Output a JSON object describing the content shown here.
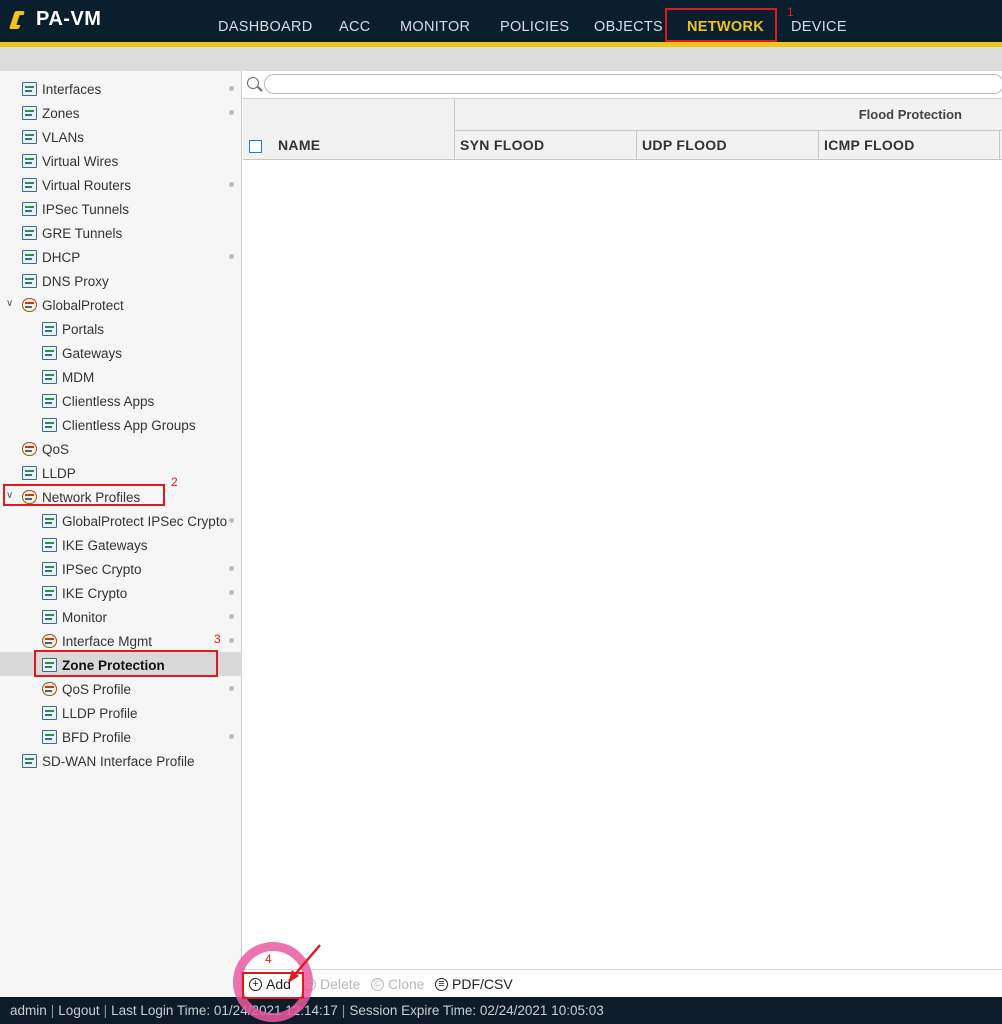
{
  "app": {
    "logo_text": "PA-VM"
  },
  "nav": {
    "tabs": [
      "DASHBOARD",
      "ACC",
      "MONITOR",
      "POLICIES",
      "OBJECTS",
      "NETWORK",
      "DEVICE"
    ],
    "active": "NETWORK"
  },
  "annotations": {
    "n1": "1",
    "n2": "2",
    "n3": "3",
    "n4": "4",
    "color": "#e0191e",
    "circle_color": "#e85aa0"
  },
  "sidebar": {
    "items": [
      "Interfaces",
      "Zones",
      "VLANs",
      "Virtual Wires",
      "Virtual Routers",
      "IPSec Tunnels",
      "GRE Tunnels",
      "DHCP",
      "DNS Proxy",
      "GlobalProtect",
      "Portals",
      "Gateways",
      "MDM",
      "Clientless Apps",
      "Clientless App Groups",
      "QoS",
      "LLDP",
      "Network Profiles",
      "GlobalProtect IPSec Crypto",
      "IKE Gateways",
      "IPSec Crypto",
      "IKE Crypto",
      "Monitor",
      "Interface Mgmt",
      "Zone Protection",
      "QoS Profile",
      "LLDP Profile",
      "BFD Profile",
      "SD-WAN Interface Profile"
    ],
    "selected": "Zone Protection"
  },
  "table": {
    "search_placeholder": "",
    "group_header": "Flood Protection",
    "columns": [
      "NAME",
      "SYN FLOOD",
      "UDP FLOOD",
      "ICMP FLOOD"
    ]
  },
  "toolbar": {
    "add": "Add",
    "delete": "Delete",
    "clone": "Clone",
    "pdf": "PDF/CSV"
  },
  "status": {
    "user": "admin",
    "logout": "Logout",
    "last_login": "Last Login Time: 01/24/2021 12:14:17",
    "session": "Session Expire Time: 02/24/2021 10:05:03"
  },
  "colors": {
    "topbar": "#0a1f2e",
    "accent": "#f0c419",
    "checkbox": "#2a7ab8"
  }
}
